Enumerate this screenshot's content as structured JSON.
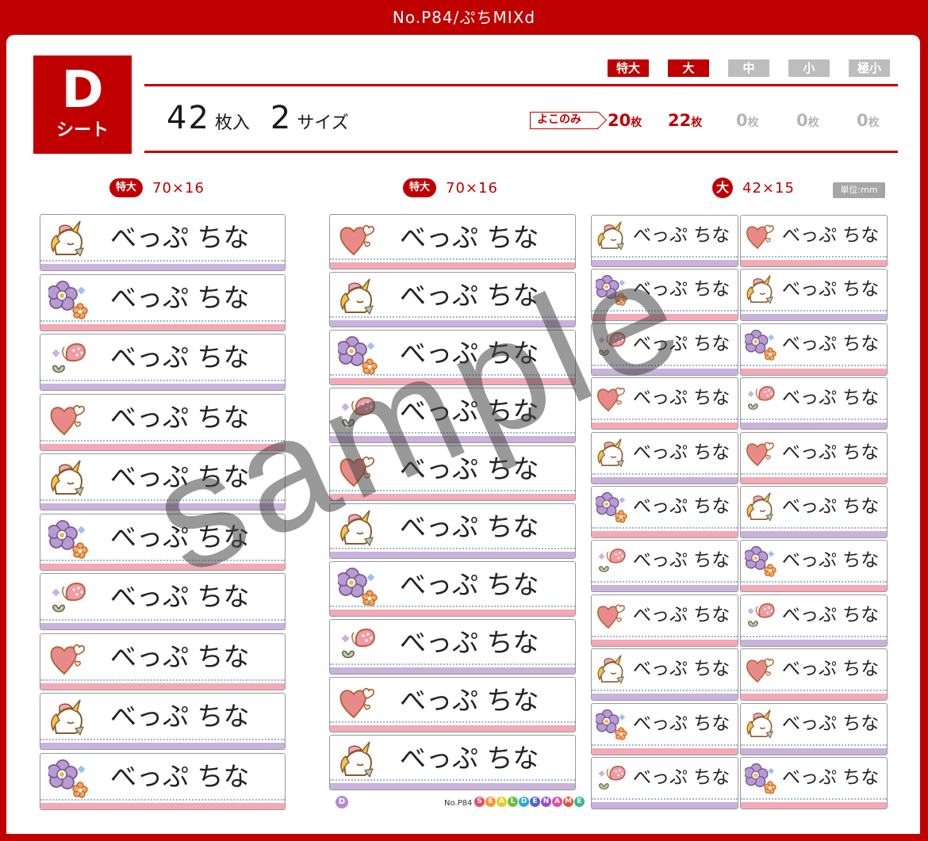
{
  "header": {
    "title": "No.P84/ぷちMIXd"
  },
  "sheet": {
    "letter": "D",
    "label": "シート"
  },
  "summary": {
    "count": "42",
    "count_unit": "枚入",
    "sizes": "2",
    "sizes_unit": "サイズ"
  },
  "size_chips": [
    {
      "label": "特大",
      "active": true
    },
    {
      "label": "大",
      "active": true
    },
    {
      "label": "中",
      "active": false
    },
    {
      "label": "小",
      "active": false
    },
    {
      "label": "極小",
      "active": false
    }
  ],
  "yoko_label": "よこのみ",
  "quantities": [
    {
      "value": "20",
      "unit": "枚",
      "active": true
    },
    {
      "value": "22",
      "unit": "枚",
      "active": true
    },
    {
      "value": "0",
      "unit": "枚",
      "active": false
    },
    {
      "value": "0",
      "unit": "枚",
      "active": false
    },
    {
      "value": "0",
      "unit": "枚",
      "active": false
    }
  ],
  "columns": [
    {
      "badge": "特大",
      "dimension": "70×16"
    },
    {
      "badge": "特大",
      "dimension": "70×16"
    },
    {
      "badge": "大",
      "dimension": "42×15"
    }
  ],
  "unit_label": "単位:mm",
  "name_text": "べっぷ ちな",
  "column1_icons": [
    "unicorn",
    "flower",
    "butterfly",
    "heart",
    "unicorn",
    "flower",
    "butterfly",
    "heart",
    "unicorn",
    "flower"
  ],
  "column1_bands": [
    "purple",
    "pink",
    "purple",
    "pink",
    "purple",
    "pink",
    "purple",
    "pink",
    "purple",
    "pink"
  ],
  "column2_icons": [
    "heart",
    "unicorn",
    "flower",
    "butterfly",
    "heart",
    "unicorn",
    "flower",
    "butterfly",
    "heart",
    "unicorn"
  ],
  "column2_bands": [
    "pink",
    "purple",
    "pink",
    "purple",
    "pink",
    "purple",
    "pink",
    "purple",
    "pink",
    "purple"
  ],
  "column3_icons": [
    "unicorn",
    "flower",
    "butterfly",
    "heart",
    "unicorn",
    "flower",
    "butterfly",
    "heart",
    "unicorn",
    "flower",
    "butterfly"
  ],
  "column3_bands": [
    "purple",
    "pink",
    "purple",
    "pink",
    "purple",
    "pink",
    "purple",
    "pink",
    "purple",
    "pink",
    "purple"
  ],
  "column4_icons": [
    "heart",
    "unicorn",
    "flower",
    "butterfly",
    "heart",
    "unicorn",
    "flower",
    "butterfly",
    "heart",
    "unicorn",
    "flower"
  ],
  "column4_bands": [
    "pink",
    "purple",
    "pink",
    "purple",
    "pink",
    "purple",
    "pink",
    "purple",
    "pink",
    "purple",
    "pink"
  ],
  "colors": {
    "accent": "#c00000",
    "band_pink": "#f3a9b6",
    "band_purple": "#c9b2db",
    "inactive": "#bdbdbd"
  },
  "watermark": "sample",
  "footer": {
    "sheet_mark": "D",
    "product_no": "No.P84",
    "brand_letters": [
      "S",
      "E",
      "A",
      "L",
      "D",
      "E",
      "N",
      "A",
      "M",
      "E"
    ]
  }
}
